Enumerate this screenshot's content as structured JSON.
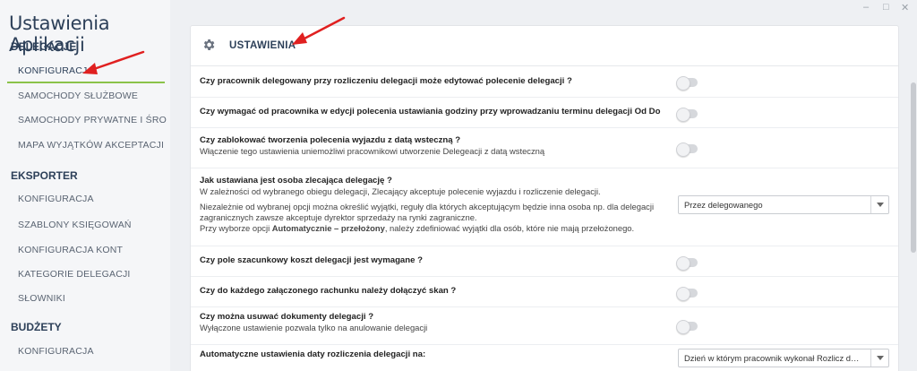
{
  "app": {
    "title": "Ustawienia Aplikacji"
  },
  "sidebar": {
    "sections": [
      {
        "title": "DELEGACJE",
        "items": [
          {
            "label": "KONFIGURACJA",
            "active": true
          },
          {
            "label": "SAMOCHODY SŁUŻBOWE"
          },
          {
            "label": "SAMOCHODY PRYWATNE I ŚROD..."
          },
          {
            "label": "MAPA WYJĄTKÓW AKCEPTACJI"
          }
        ]
      },
      {
        "title": "EKSPORTER",
        "items": [
          {
            "label": "KONFIGURACJA"
          },
          {
            "label": "SZABLONY KSIĘGOWAŃ"
          },
          {
            "label": "KONFIGURACJA KONT"
          },
          {
            "label": "KATEGORIE DELEGACJI"
          },
          {
            "label": "SŁOWNIKI"
          }
        ]
      },
      {
        "title": "BUDŻETY",
        "items": [
          {
            "label": "KONFIGURACJA"
          }
        ]
      }
    ]
  },
  "window": {
    "minimize": "–",
    "maximize": "□",
    "close": "✕"
  },
  "panel": {
    "title": "USTAWIENIA",
    "icon": "gear-icon",
    "settings": [
      {
        "question": "Czy pracownik delegowany przy rozliczeniu delegacji może edytować polecenie delegacji ?",
        "enabled": false
      },
      {
        "question": "Czy wymagać od pracownika w edycji polecenia ustawiania godziny przy wprowadzaniu terminu delegacji Od Do",
        "enabled": false
      },
      {
        "question": "Czy zablokować tworzenia polecenia wyjazdu z datą wsteczną ?",
        "description": "Włączenie tego ustawienia uniemożliwi pracownikowi utworzenie Delegeacji z datą wsteczną",
        "enabled": false
      },
      {
        "question": "Jak ustawiana jest osoba zlecająca delegację ?",
        "description": "W zależności od wybranego obiegu delegacji, Zlecający akceptuje polecenie wyjazdu i rozliczenie delegacji.",
        "note_line1": "Niezależnie od wybranej opcji można określić wyjątki, reguły dla których akceptującym będzie inna osoba np. dla delegacji",
        "note_line2": "zagranicznych zawsze akceptuje dyrektor sprzedaży na rynki zagraniczne.",
        "note_line3_prefix": "Przy wyborze opcji ",
        "note_line3_bold": "Automatycznie – przełożony",
        "note_line3_suffix": ", należy zdefiniować wyjątki dla osób, które nie mają przełożonego.",
        "select_value": "Przez delegowanego"
      },
      {
        "question": "Czy pole szacunkowy koszt delegacji jest wymagane ?",
        "enabled": false
      },
      {
        "question": "Czy do każdego załączonego rachunku należy dołączyć skan ?",
        "enabled": false
      },
      {
        "question": "Czy można usuwać dokumenty delegacji ?",
        "description": "Wyłączone ustawienie pozwala tylko na anulowanie delegacji",
        "enabled": false
      },
      {
        "question": "Automatyczne ustawienia daty rozliczenia delegacji na:",
        "select_value": "Dzień w którym pracownik wykonał Rozlicz delegację"
      }
    ]
  },
  "colors": {
    "accent": "#8bc34a",
    "title": "#2d4059",
    "annotation_arrow": "#e02020"
  }
}
